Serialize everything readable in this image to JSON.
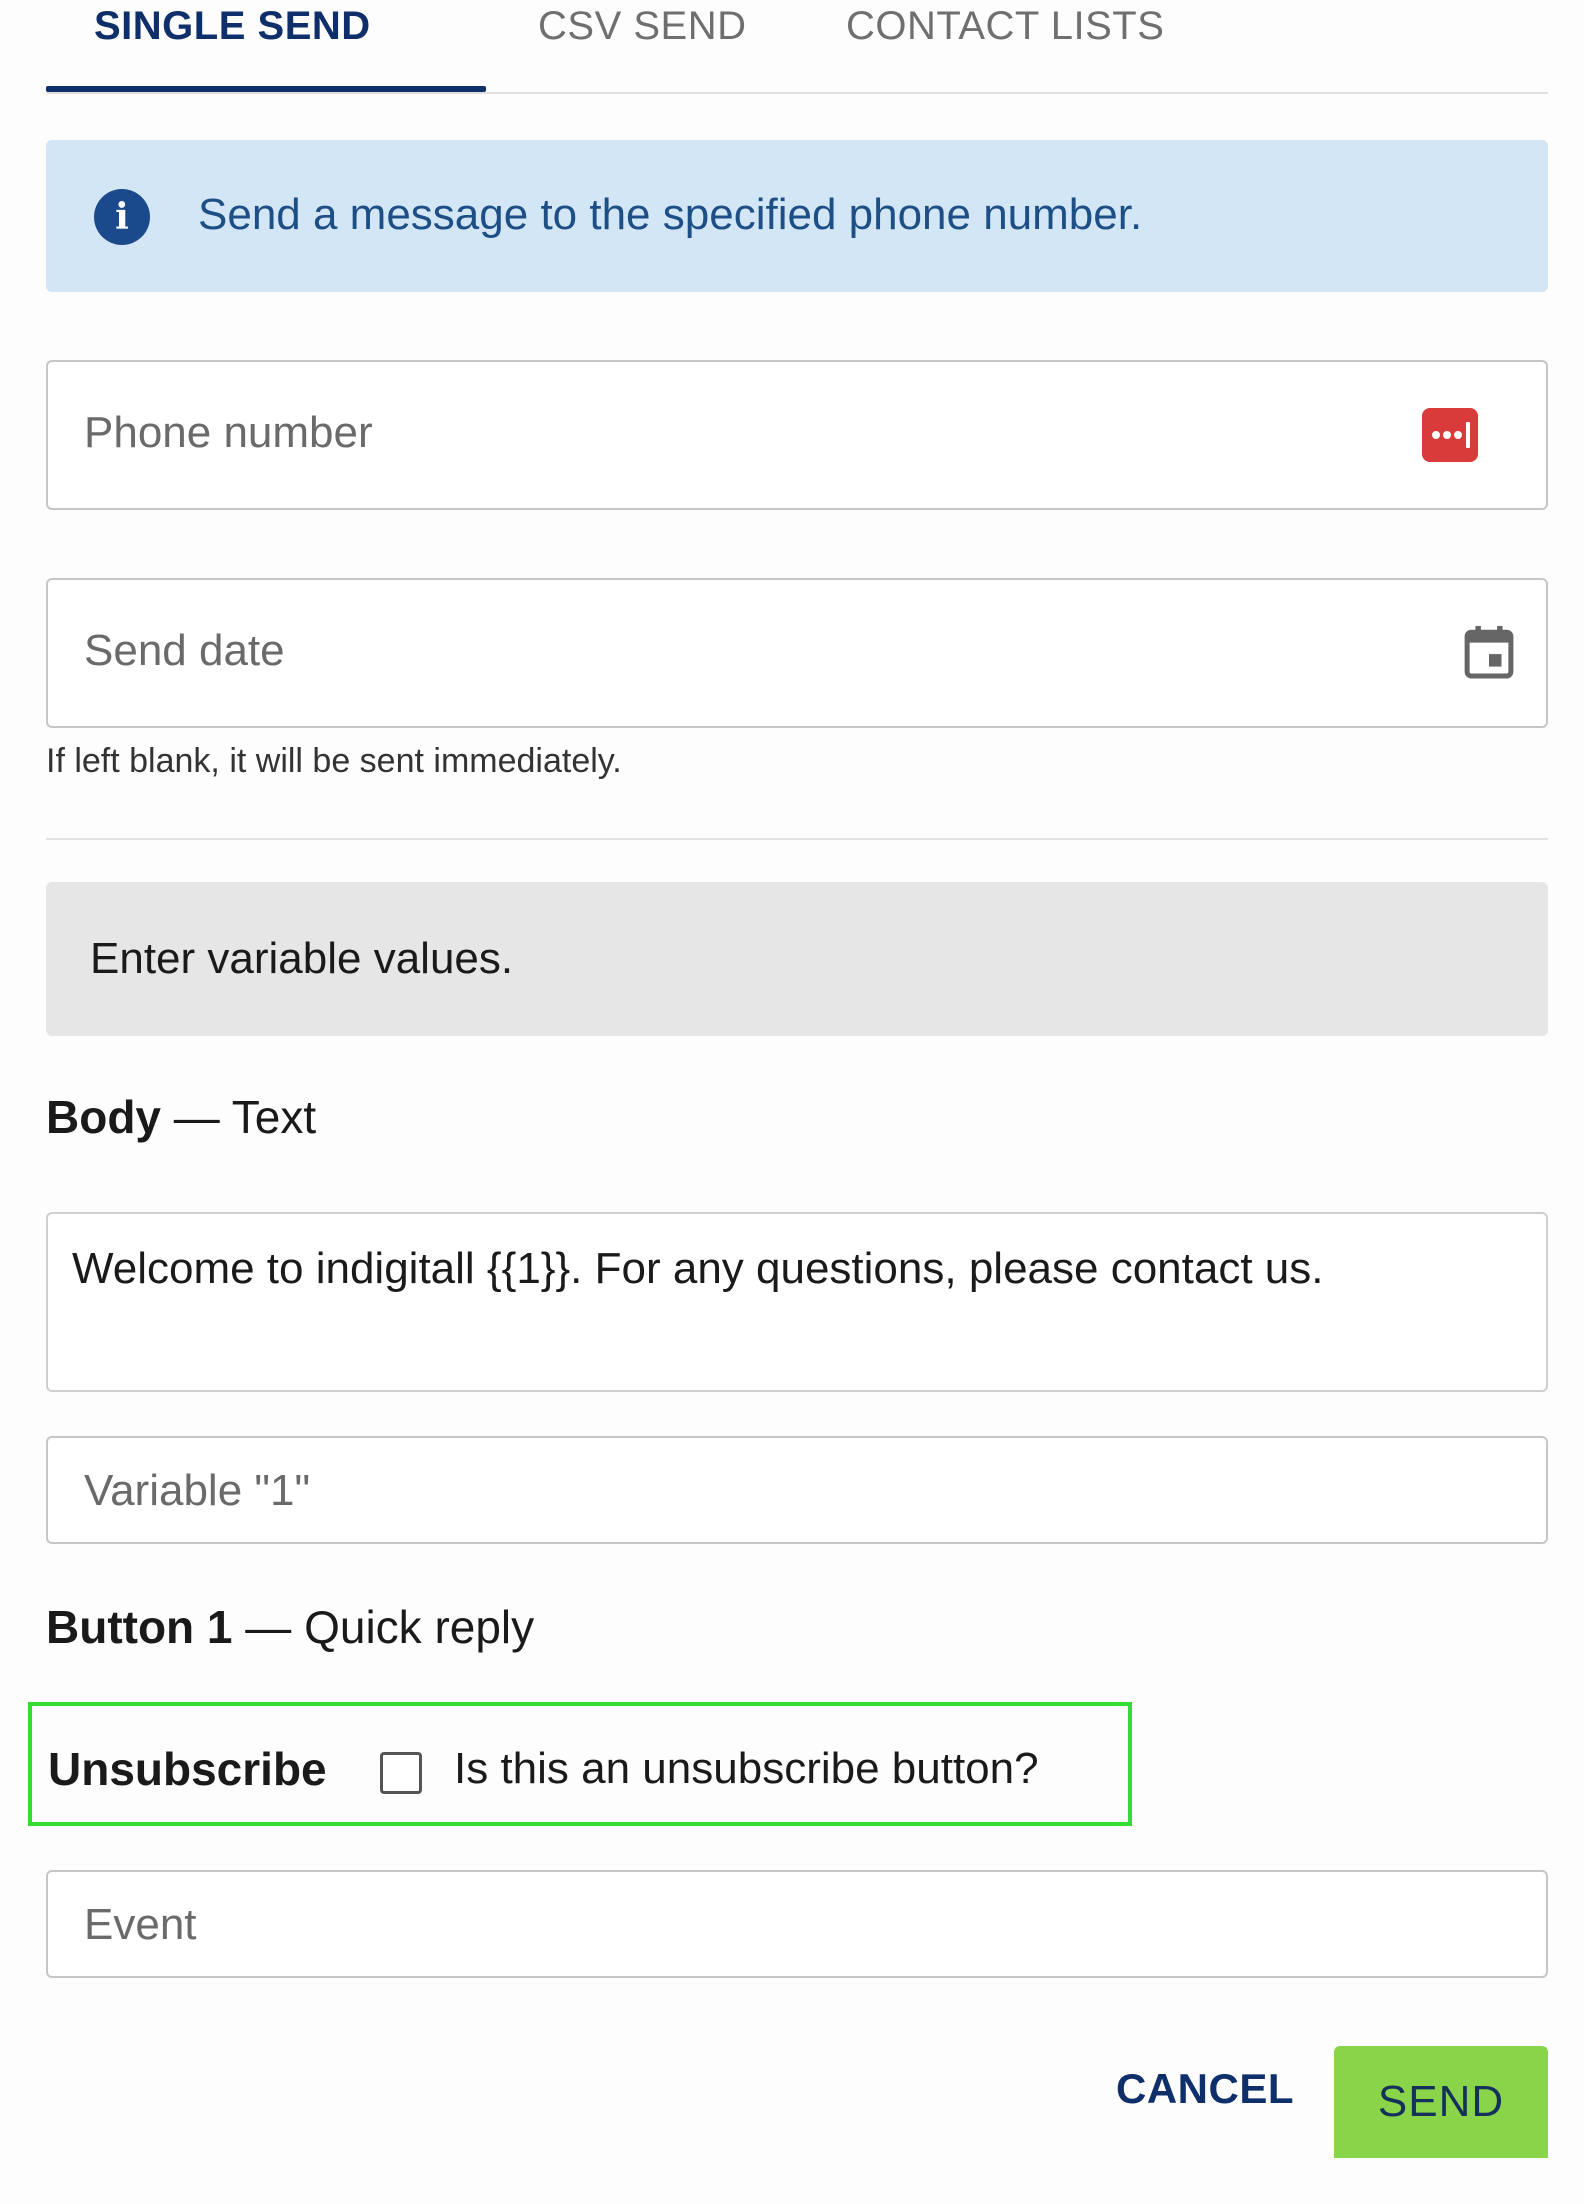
{
  "tabs": [
    {
      "label": "SINGLE SEND",
      "active": true
    },
    {
      "label": "CSV SEND",
      "active": false
    },
    {
      "label": "CONTACT LISTS",
      "active": false
    }
  ],
  "alert": {
    "icon": "info-icon",
    "text": "Send a message to the specified phone number."
  },
  "phone": {
    "placeholder": "Phone number",
    "icon": "password-manager-icon"
  },
  "send_date": {
    "placeholder": "Send date",
    "icon": "calendar-icon",
    "helper": "If left blank, it will be sent immediately."
  },
  "variables": {
    "heading": "Enter variable values."
  },
  "body_section": {
    "label_bold": "Body",
    "label_rest": " — Text",
    "text": "Welcome to indigitall {{1}}. For any questions, please contact us.",
    "variable_placeholder": "Variable \"1\""
  },
  "button_section": {
    "label_bold": "Button 1",
    "label_rest": " — Quick reply",
    "unsubscribe_label": "Unsubscribe",
    "unsubscribe_question": "Is this an unsubscribe button?",
    "unsubscribe_checked": false,
    "event_placeholder": "Event"
  },
  "actions": {
    "cancel": "CANCEL",
    "send": "SEND"
  },
  "colors": {
    "primary": "#0f2f6b",
    "alert_bg": "#d2e6f5",
    "send_bg": "#8ad44a",
    "highlight": "#33dd33",
    "password_icon": "#d93a3a"
  }
}
